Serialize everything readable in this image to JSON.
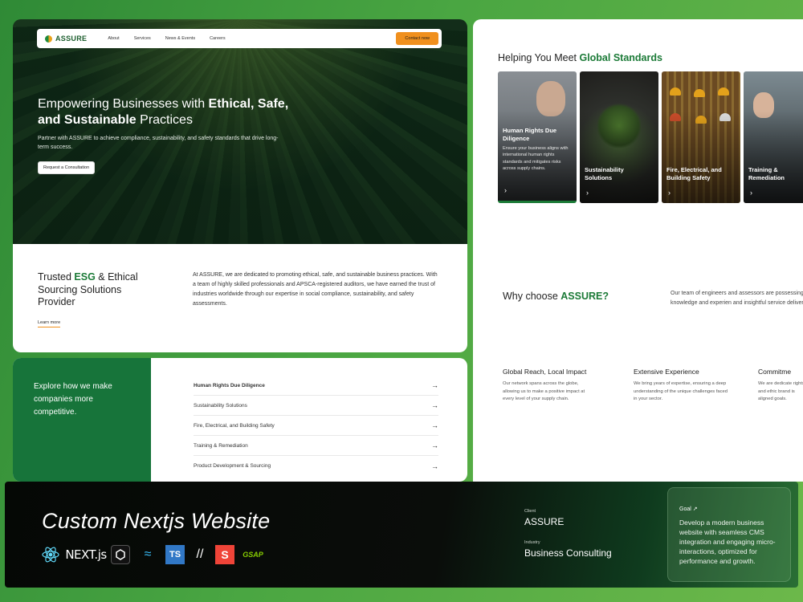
{
  "nav": {
    "logo": "ASSURE",
    "links": [
      "About",
      "Services",
      "News & Events",
      "Careers"
    ],
    "contact": "Contact now"
  },
  "hero": {
    "title_a": "Empowering Businesses with ",
    "title_b": "Ethical, Safe,",
    "title_c": "and Sustainable",
    "title_d": " Practices",
    "subtitle": "Partner with ASSURE to achieve compliance, sustainability, and safety standards that drive long-term success.",
    "button": "Request a Consultation"
  },
  "trust": {
    "title_a": "Trusted ",
    "title_b": "ESG",
    "title_c": " & Ethical Sourcing Solutions Provider",
    "learn": "Learn more",
    "body": "At ASSURE, we are dedicated to promoting ethical, safe, and sustainable business practices. With a team of highly skilled professionals and APSCA-registered auditors, we have earned the trust of industries worldwide through our expertise in social compliance, sustainability, and safety assessments."
  },
  "explore": {
    "text": "Explore how we make companies more competitive.",
    "items": [
      "Human Rights Due Diligence",
      "Sustainability Solutions",
      "Fire, Electrical, and Building Safety",
      "Training & Remediation",
      "Product Development & Sourcing"
    ]
  },
  "standards": {
    "title_a": "Helping You Meet ",
    "title_b": "Global Standards",
    "cards": [
      {
        "title": "Human Rights Due Diligence",
        "desc": "Ensure your business aligns with international human rights standards and mitigates risks across supply chains."
      },
      {
        "title": "Sustainability Solutions"
      },
      {
        "title": "Fire, Electrical, and Building Safety"
      },
      {
        "title": "Training & Remediation"
      }
    ]
  },
  "why": {
    "title_a": "Why choose ",
    "title_b": "ASSURE?",
    "text": "Our team of engineers and assessors are possessing the knowledge and experien and insightful service delivery.",
    "features": [
      {
        "title": "Global Reach, Local Impact",
        "text": "Our network spans across the globe, allowing us to make a positive impact at every level of your supply chain."
      },
      {
        "title": "Extensive Experience",
        "text": "We bring years of expertise, ensuring a deep understanding of the unique challenges faced in your sector."
      },
      {
        "title": "Commitme",
        "text": "We are dedicate rights and ethic brand is aligned goals."
      }
    ]
  },
  "showcase": {
    "title": "Custom Nextjs Website",
    "tech": [
      "react-icon",
      "NEXT.js",
      "shadcn-icon",
      "tailwind-icon",
      "TS",
      "slash-icon",
      "S",
      "GSAP"
    ],
    "client_label": "Client",
    "client": "ASSURE",
    "industry_label": "Industry",
    "industry": "Business Consulting",
    "goal_label": "Goal",
    "goal": "Develop a modern business website with seamless CMS integration and engaging micro-interactions, optimized for performance and growth."
  }
}
